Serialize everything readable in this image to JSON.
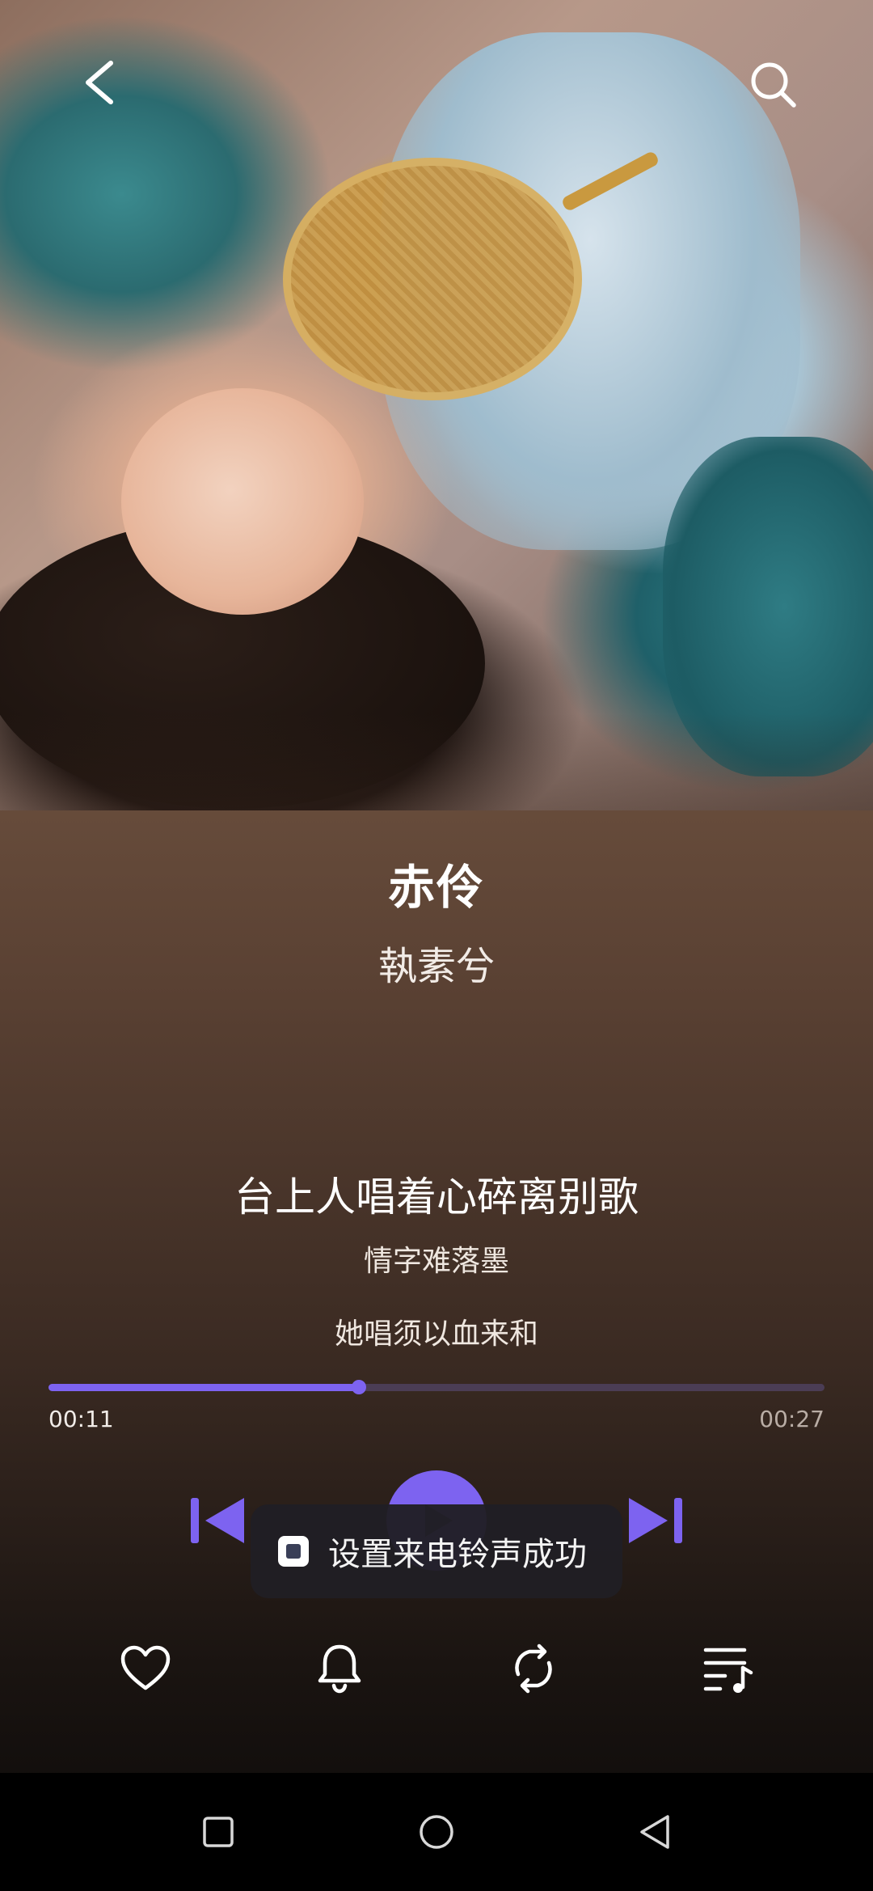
{
  "song": {
    "title": "赤伶",
    "artist": "執素兮"
  },
  "lyrics": {
    "current": "台上人唱着心碎离别歌",
    "next": "情字难落墨",
    "following": "她唱须以血来和"
  },
  "playback": {
    "elapsed": "00:11",
    "total": "00:27",
    "progress_fraction": 0.4,
    "state": "paused"
  },
  "toast": {
    "message": "设置来电铃声成功",
    "icon": "app-icon"
  },
  "icons": {
    "back": "chevron-left-icon",
    "search": "search-icon",
    "prev": "skip-previous-icon",
    "play": "play-icon",
    "next": "skip-next-icon",
    "like": "heart-icon",
    "ringtone": "bell-icon",
    "repeat": "repeat-icon",
    "queue": "playlist-icon",
    "nav_recent": "square-icon",
    "nav_home": "circle-icon",
    "nav_back": "triangle-back-icon"
  },
  "colors": {
    "accent": "#7d63f0",
    "track": "#4b3d55",
    "toast_bg": "#201e24"
  }
}
